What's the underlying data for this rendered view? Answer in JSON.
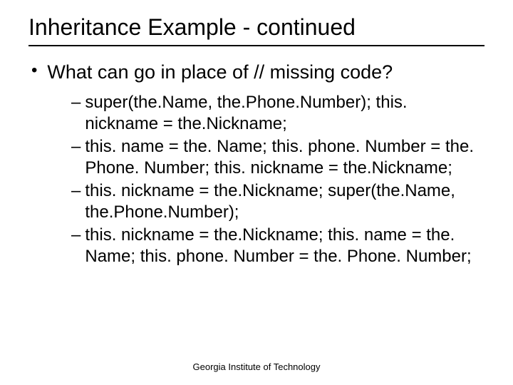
{
  "title": "Inheritance Example - continued",
  "bullet": {
    "text": "What can go in place of // missing code?"
  },
  "options": [
    "super(the.Name, the.Phone.Number); this. nickname = the.Nickname;",
    "this. name = the. Name; this. phone. Number = the. Phone. Number; this. nickname = the.Nickname;",
    "this. nickname = the.Nickname; super(the.Name, the.Phone.Number);",
    "this. nickname = the.Nickname; this. name = the. Name; this. phone. Number = the. Phone. Number;"
  ],
  "footer": "Georgia Institute of Technology"
}
